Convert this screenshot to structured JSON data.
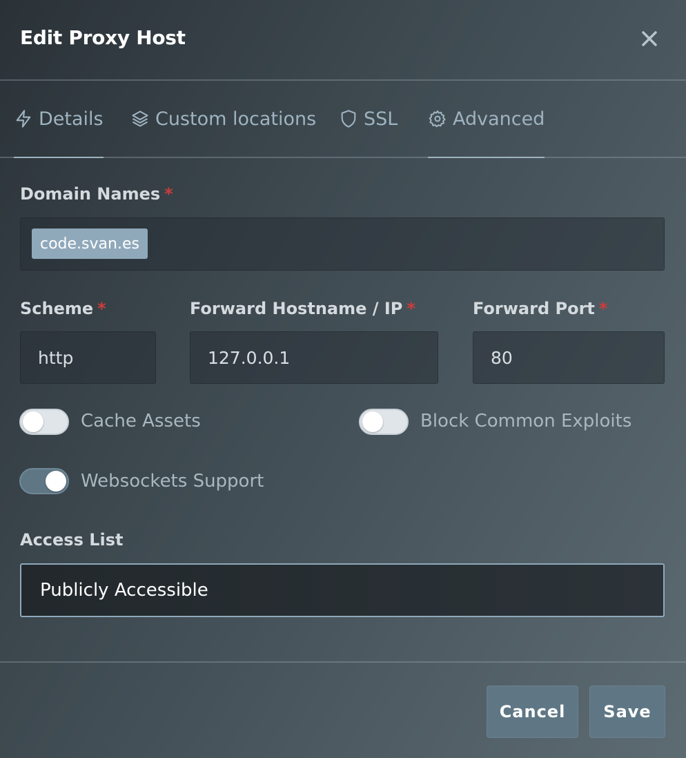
{
  "dialog": {
    "title": "Edit Proxy Host",
    "close_icon": "close-icon"
  },
  "tabs": [
    {
      "label": "Details",
      "icon": "bolt-icon"
    },
    {
      "label": "Custom locations",
      "icon": "layers-icon"
    },
    {
      "label": "SSL",
      "icon": "shield-icon"
    },
    {
      "label": "Advanced",
      "icon": "gear-icon"
    }
  ],
  "form": {
    "domain_names": {
      "label": "Domain Names",
      "required_mark": "*",
      "chips": [
        "code.svan.es"
      ]
    },
    "scheme": {
      "label": "Scheme",
      "required_mark": "*",
      "value": "http"
    },
    "forward_host": {
      "label": "Forward Hostname / IP",
      "required_mark": "*",
      "value": "127.0.0.1"
    },
    "forward_port": {
      "label": "Forward Port",
      "required_mark": "*",
      "value": "80"
    },
    "toggles": {
      "cache_assets": {
        "label": "Cache Assets",
        "on": false
      },
      "block_exploits": {
        "label": "Block Common Exploits",
        "on": false
      },
      "websockets": {
        "label": "Websockets Support",
        "on": true
      }
    },
    "access_list": {
      "label": "Access List",
      "value": "Publicly Accessible"
    }
  },
  "footer": {
    "cancel_label": "Cancel",
    "save_label": "Save"
  },
  "colors": {
    "accent": "#5f7785",
    "required": "#cd3c3c",
    "chip": "#8fa9bb"
  }
}
